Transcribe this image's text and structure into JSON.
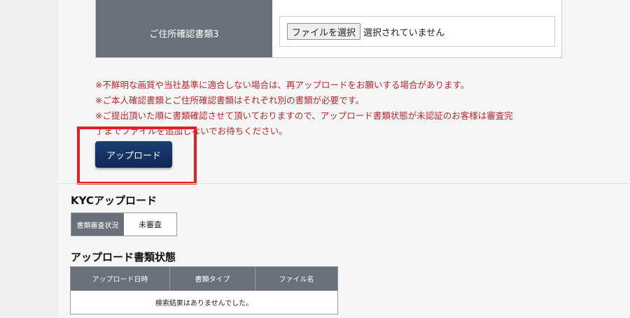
{
  "upload_form": {
    "row_label": "ご住所確認書類3",
    "file_button_label": "ファイルを選択",
    "file_status": "選択されていません"
  },
  "notes": [
    "※不鮮明な画質や当社基準に適合しない場合は、再アップロードをお願いする場合があります。",
    "※ご本人確認書類とご住所確認書類はそれぞれ別の書類が必要です。",
    "※ご提出頂いた順に書類確認させて頂いておりますので、アップロード書類状態が未認証のお客様は審査完",
    "了までファイルを追加しないでお待ちください。"
  ],
  "upload_button_label": "アップロード",
  "kyc": {
    "title": "KYCアップロード",
    "status_header": "書類審査状況",
    "status_value": "未審査"
  },
  "upload_status": {
    "title": "アップロード書類状態",
    "columns": [
      "アップロード日時",
      "書類タイプ",
      "ファイル名"
    ],
    "empty_message": "検索結果はありませんでした。"
  },
  "colors": {
    "header_gray": "#6a7079",
    "note_red": "#b3282d",
    "button_navy": "#0e2856",
    "highlight_red": "#e3202a"
  }
}
